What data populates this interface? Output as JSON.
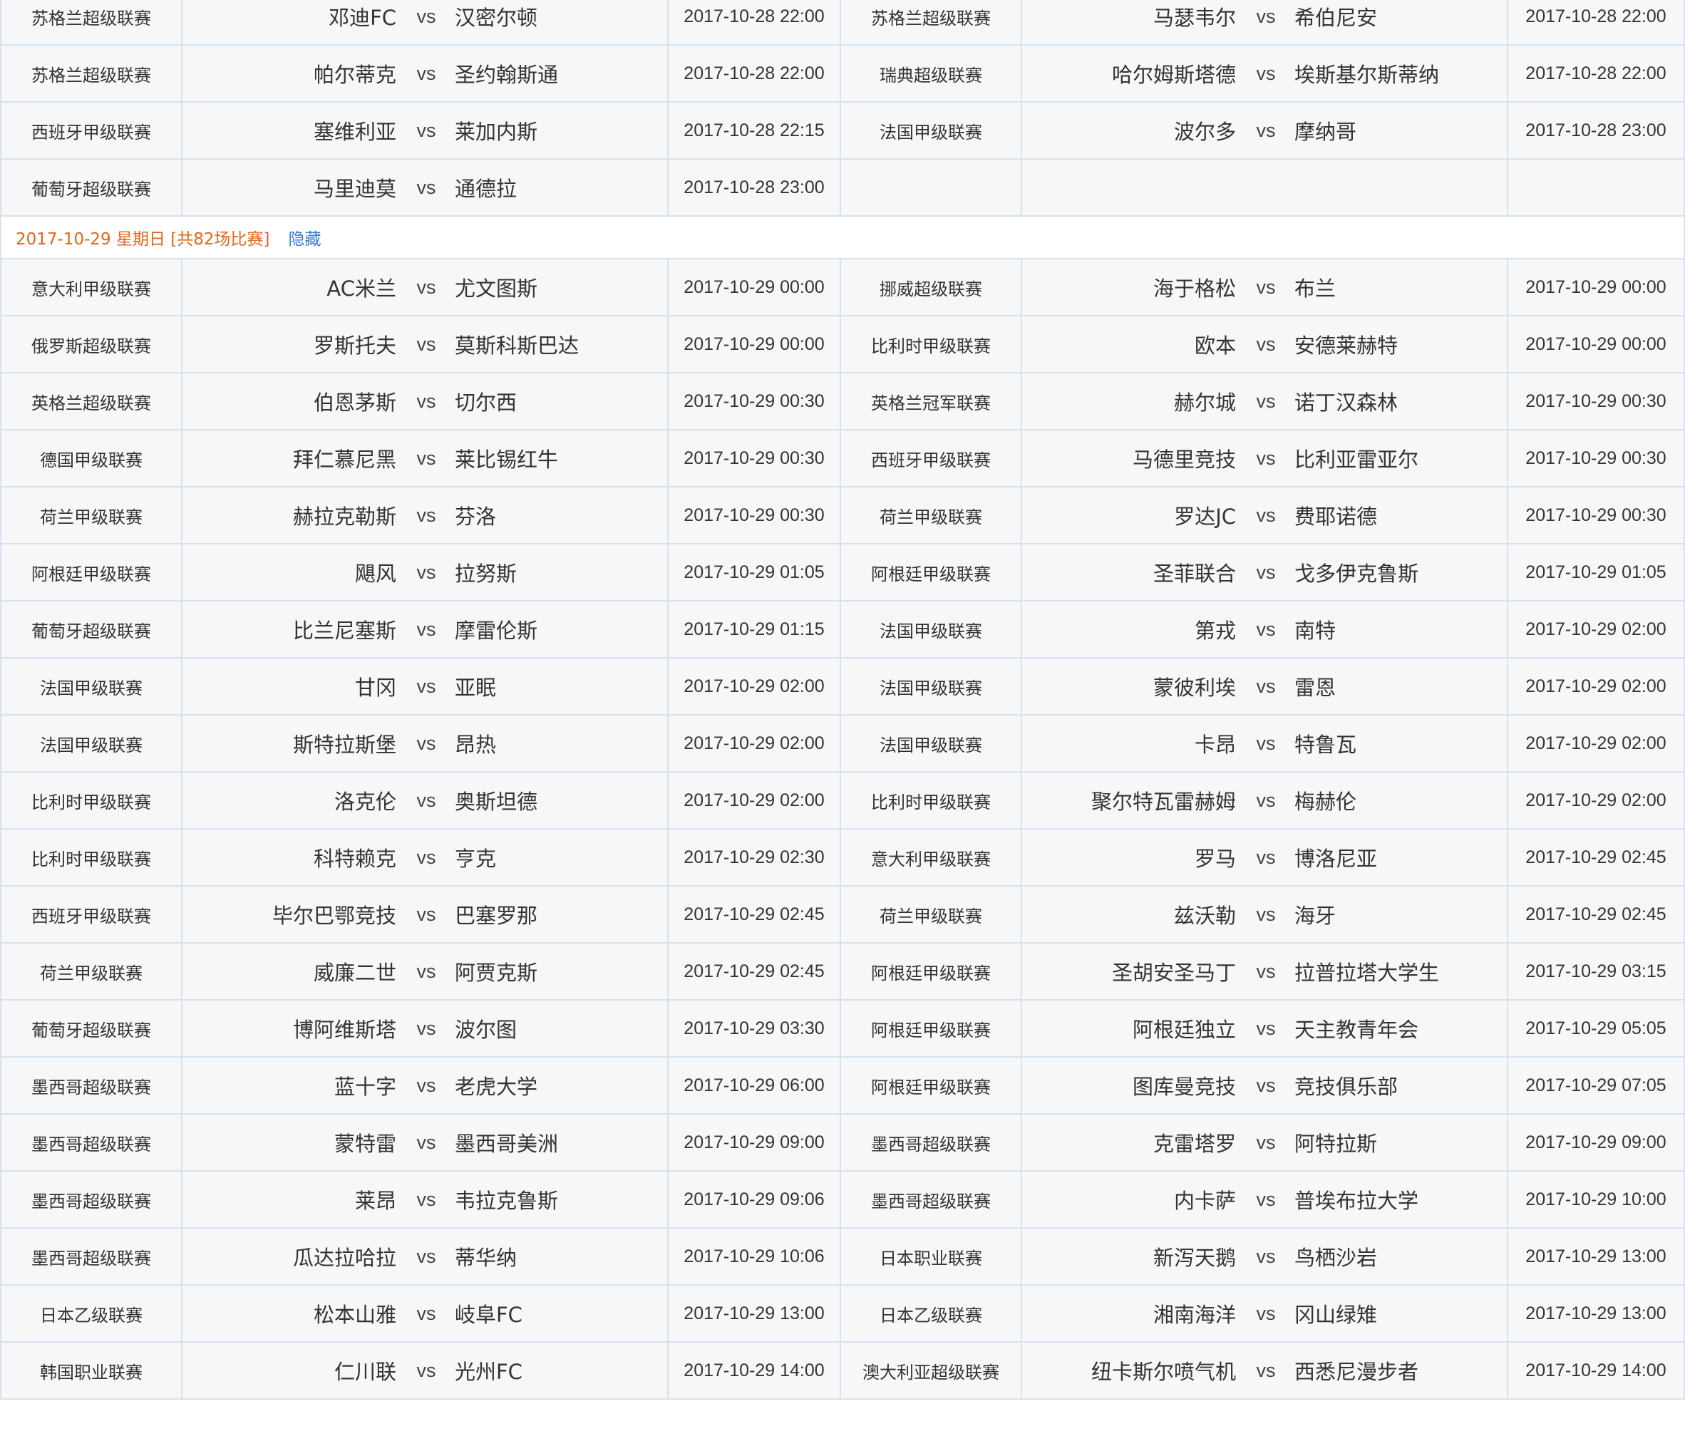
{
  "vs_label": "vs",
  "colors": {
    "accent_orange": "#e0661c",
    "link_blue": "#3a7bd5",
    "border": "#d6e3ef",
    "cell_bg": "#f7f7f7"
  },
  "oct28_rows": [
    [
      {
        "league": "苏格兰超级联赛",
        "home": "邓迪FC",
        "away": "汉密尔顿",
        "time": "2017-10-28 22:00"
      },
      {
        "league": "苏格兰超级联赛",
        "home": "马瑟韦尔",
        "away": "希伯尼安",
        "time": "2017-10-28 22:00"
      }
    ],
    [
      {
        "league": "苏格兰超级联赛",
        "home": "帕尔蒂克",
        "away": "圣约翰斯通",
        "time": "2017-10-28 22:00"
      },
      {
        "league": "瑞典超级联赛",
        "home": "哈尔姆斯塔德",
        "away": "埃斯基尔斯蒂纳",
        "time": "2017-10-28 22:00"
      }
    ],
    [
      {
        "league": "西班牙甲级联赛",
        "home": "塞维利亚",
        "away": "莱加内斯",
        "time": "2017-10-28 22:15"
      },
      {
        "league": "法国甲级联赛",
        "home": "波尔多",
        "away": "摩纳哥",
        "time": "2017-10-28 23:00"
      }
    ],
    [
      {
        "league": "葡萄牙超级联赛",
        "home": "马里迪莫",
        "away": "通德拉",
        "time": "2017-10-28 23:00"
      },
      null
    ]
  ],
  "day_header": {
    "label": "2017-10-29 星期日 [共82场比赛]",
    "hide_link": "隐藏"
  },
  "oct29_rows": [
    [
      {
        "league": "意大利甲级联赛",
        "home": "AC米兰",
        "away": "尤文图斯",
        "time": "2017-10-29 00:00"
      },
      {
        "league": "挪威超级联赛",
        "home": "海于格松",
        "away": "布兰",
        "time": "2017-10-29 00:00"
      }
    ],
    [
      {
        "league": "俄罗斯超级联赛",
        "home": "罗斯托夫",
        "away": "莫斯科斯巴达",
        "time": "2017-10-29 00:00"
      },
      {
        "league": "比利时甲级联赛",
        "home": "欧本",
        "away": "安德莱赫特",
        "time": "2017-10-29 00:00"
      }
    ],
    [
      {
        "league": "英格兰超级联赛",
        "home": "伯恩茅斯",
        "away": "切尔西",
        "time": "2017-10-29 00:30"
      },
      {
        "league": "英格兰冠军联赛",
        "home": "赫尔城",
        "away": "诺丁汉森林",
        "time": "2017-10-29 00:30"
      }
    ],
    [
      {
        "league": "德国甲级联赛",
        "home": "拜仁慕尼黑",
        "away": "莱比锡红牛",
        "time": "2017-10-29 00:30"
      },
      {
        "league": "西班牙甲级联赛",
        "home": "马德里竞技",
        "away": "比利亚雷亚尔",
        "time": "2017-10-29 00:30"
      }
    ],
    [
      {
        "league": "荷兰甲级联赛",
        "home": "赫拉克勒斯",
        "away": "芬洛",
        "time": "2017-10-29 00:30"
      },
      {
        "league": "荷兰甲级联赛",
        "home": "罗达JC",
        "away": "费耶诺德",
        "time": "2017-10-29 00:30"
      }
    ],
    [
      {
        "league": "阿根廷甲级联赛",
        "home": "飓风",
        "away": "拉努斯",
        "time": "2017-10-29 01:05"
      },
      {
        "league": "阿根廷甲级联赛",
        "home": "圣菲联合",
        "away": "戈多伊克鲁斯",
        "time": "2017-10-29 01:05"
      }
    ],
    [
      {
        "league": "葡萄牙超级联赛",
        "home": "比兰尼塞斯",
        "away": "摩雷伦斯",
        "time": "2017-10-29 01:15"
      },
      {
        "league": "法国甲级联赛",
        "home": "第戎",
        "away": "南特",
        "time": "2017-10-29 02:00"
      }
    ],
    [
      {
        "league": "法国甲级联赛",
        "home": "甘冈",
        "away": "亚眠",
        "time": "2017-10-29 02:00"
      },
      {
        "league": "法国甲级联赛",
        "home": "蒙彼利埃",
        "away": "雷恩",
        "time": "2017-10-29 02:00"
      }
    ],
    [
      {
        "league": "法国甲级联赛",
        "home": "斯特拉斯堡",
        "away": "昂热",
        "time": "2017-10-29 02:00"
      },
      {
        "league": "法国甲级联赛",
        "home": "卡昂",
        "away": "特鲁瓦",
        "time": "2017-10-29 02:00"
      }
    ],
    [
      {
        "league": "比利时甲级联赛",
        "home": "洛克伦",
        "away": "奥斯坦德",
        "time": "2017-10-29 02:00"
      },
      {
        "league": "比利时甲级联赛",
        "home": "聚尔特瓦雷赫姆",
        "away": "梅赫伦",
        "time": "2017-10-29 02:00"
      }
    ],
    [
      {
        "league": "比利时甲级联赛",
        "home": "科特赖克",
        "away": "亨克",
        "time": "2017-10-29 02:30"
      },
      {
        "league": "意大利甲级联赛",
        "home": "罗马",
        "away": "博洛尼亚",
        "time": "2017-10-29 02:45"
      }
    ],
    [
      {
        "league": "西班牙甲级联赛",
        "home": "毕尔巴鄂竞技",
        "away": "巴塞罗那",
        "time": "2017-10-29 02:45"
      },
      {
        "league": "荷兰甲级联赛",
        "home": "兹沃勒",
        "away": "海牙",
        "time": "2017-10-29 02:45"
      }
    ],
    [
      {
        "league": "荷兰甲级联赛",
        "home": "威廉二世",
        "away": "阿贾克斯",
        "time": "2017-10-29 02:45"
      },
      {
        "league": "阿根廷甲级联赛",
        "home": "圣胡安圣马丁",
        "away": "拉普拉塔大学生",
        "time": "2017-10-29 03:15"
      }
    ],
    [
      {
        "league": "葡萄牙超级联赛",
        "home": "博阿维斯塔",
        "away": "波尔图",
        "time": "2017-10-29 03:30"
      },
      {
        "league": "阿根廷甲级联赛",
        "home": "阿根廷独立",
        "away": "天主教青年会",
        "time": "2017-10-29 05:05"
      }
    ],
    [
      {
        "league": "墨西哥超级联赛",
        "home": "蓝十字",
        "away": "老虎大学",
        "time": "2017-10-29 06:00"
      },
      {
        "league": "阿根廷甲级联赛",
        "home": "图库曼竞技",
        "away": "竞技俱乐部",
        "time": "2017-10-29 07:05"
      }
    ],
    [
      {
        "league": "墨西哥超级联赛",
        "home": "蒙特雷",
        "away": "墨西哥美洲",
        "time": "2017-10-29 09:00"
      },
      {
        "league": "墨西哥超级联赛",
        "home": "克雷塔罗",
        "away": "阿特拉斯",
        "time": "2017-10-29 09:00"
      }
    ],
    [
      {
        "league": "墨西哥超级联赛",
        "home": "莱昂",
        "away": "韦拉克鲁斯",
        "time": "2017-10-29 09:06"
      },
      {
        "league": "墨西哥超级联赛",
        "home": "内卡萨",
        "away": "普埃布拉大学",
        "time": "2017-10-29 10:00"
      }
    ],
    [
      {
        "league": "墨西哥超级联赛",
        "home": "瓜达拉哈拉",
        "away": "蒂华纳",
        "time": "2017-10-29 10:06"
      },
      {
        "league": "日本职业联赛",
        "home": "新泻天鹅",
        "away": "鸟栖沙岩",
        "time": "2017-10-29 13:00"
      }
    ],
    [
      {
        "league": "日本乙级联赛",
        "home": "松本山雅",
        "away": "岐阜FC",
        "time": "2017-10-29 13:00"
      },
      {
        "league": "日本乙级联赛",
        "home": "湘南海洋",
        "away": "冈山绿雉",
        "time": "2017-10-29 13:00"
      }
    ],
    [
      {
        "league": "韩国职业联赛",
        "home": "仁川联",
        "away": "光州FC",
        "time": "2017-10-29 14:00"
      },
      {
        "league": "澳大利亚超级联赛",
        "home": "纽卡斯尔喷气机",
        "away": "西悉尼漫步者",
        "time": "2017-10-29 14:00"
      }
    ]
  ]
}
